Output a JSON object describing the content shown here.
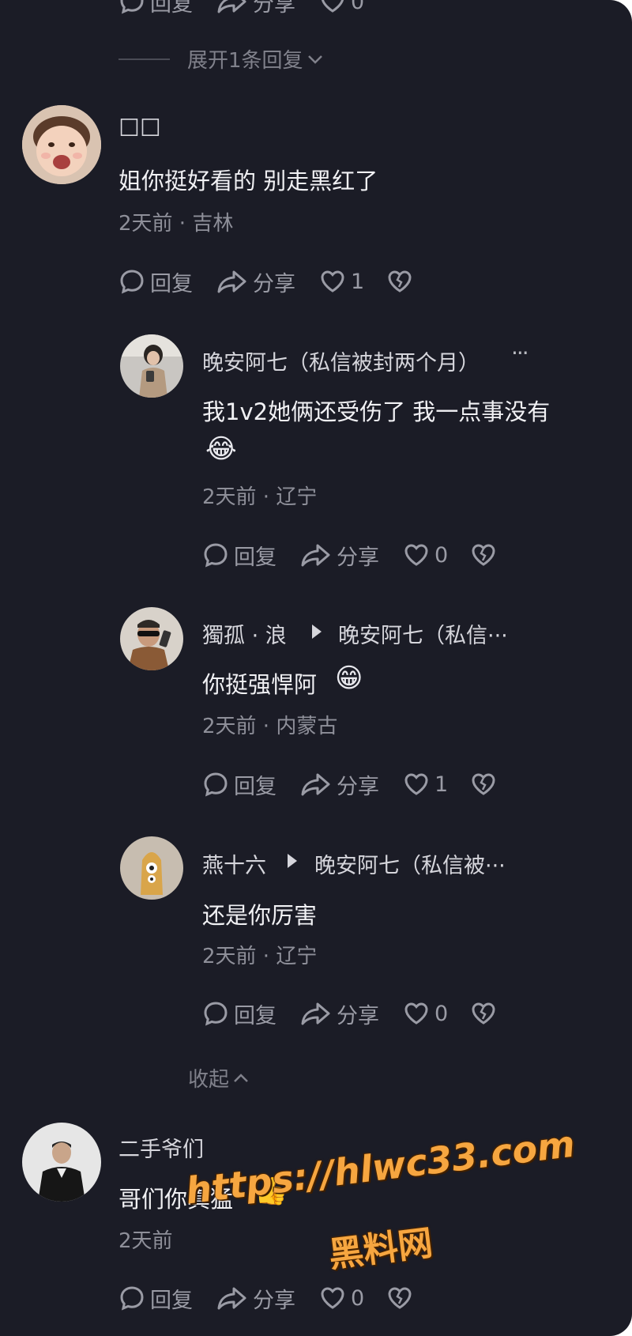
{
  "top_partial": {
    "reply": "回复",
    "share": "分享",
    "likes": "0"
  },
  "expand_text": "展开1条回复",
  "collapse_text": "收起",
  "comments": [
    {
      "name": "☐☐",
      "text": "姐你挺好看的 别走黑红了",
      "meta": "2天前 · 吉林",
      "reply": "回复",
      "share": "分享",
      "likes": "1"
    },
    {
      "name": "晚安阿七（私信被封两个月）",
      "more": "···",
      "text": "我1v2她俩还受伤了 我一点事没有",
      "emoji": "😂",
      "meta": "2天前 · 辽宁",
      "reply": "回复",
      "share": "分享",
      "likes": "0"
    },
    {
      "name": "獨孤 · 浪",
      "target": "晚安阿七（私信···",
      "text": "你挺强悍阿",
      "emoji": "😁",
      "meta": "2天前 · 内蒙古",
      "reply": "回复",
      "share": "分享",
      "likes": "1"
    },
    {
      "name": "燕十六",
      "target": "晚安阿七（私信被···",
      "text": "还是你厉害",
      "meta": "2天前 · 辽宁",
      "reply": "回复",
      "share": "分享",
      "likes": "0"
    },
    {
      "name": "二手爷们",
      "text": "哥们你真猛",
      "emoji": "👍",
      "meta": "2天前",
      "reply": "回复",
      "share": "分享",
      "likes": "0"
    }
  ],
  "watermark": {
    "line1": "https://hlwc33.com",
    "line2": "黑料网"
  },
  "colors": {
    "background": "#1b1c26",
    "watermark": "#f6a640"
  }
}
